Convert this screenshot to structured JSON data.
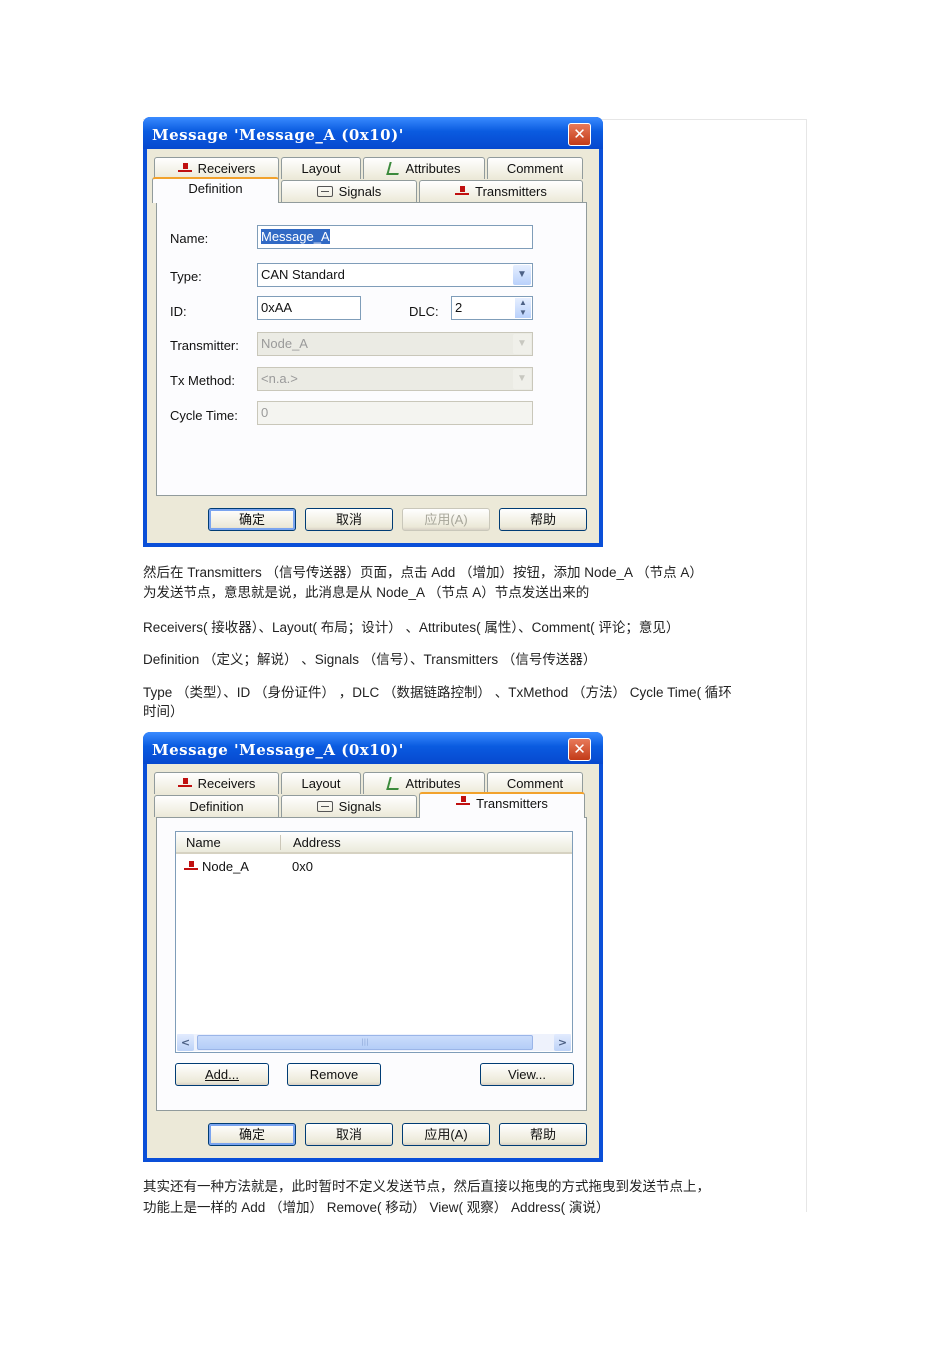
{
  "dialog1": {
    "title": "Message 'Message_A (0x10)'",
    "close_glyph": "✕",
    "tabs_row1": [
      "Receivers",
      "Layout",
      "Attributes",
      "Comment"
    ],
    "tabs_row2": [
      "Definition",
      "Signals",
      "Transmitters"
    ],
    "active_tab": "Definition",
    "fields": {
      "name_label": "Name:",
      "name_value": "Message_A",
      "type_label": "Type:",
      "type_value": "CAN Standard",
      "id_label": "ID:",
      "id_value": "0xAA",
      "dlc_label": "DLC:",
      "dlc_value": "2",
      "transmitter_label": "Transmitter:",
      "transmitter_value": "Node_A",
      "txmethod_label": "Tx Method:",
      "txmethod_value": "<n.a.>",
      "cycletime_label": "Cycle Time:",
      "cycletime_value": "0"
    },
    "buttons": {
      "ok": "确定",
      "cancel": "取消",
      "apply": "应用(A)",
      "help": "帮助"
    }
  },
  "text1": {
    "line1": "然后在   Transmitters      （信号传送器）页面，点击      Add （增加）按钮，添加      Node_A   （节点  A）",
    "line2": "为发送节点，意思就是说，此消息是从         Node_A   （节点   A）节点发送出来的",
    "line3": "Receivers(    接收器）、Layout(    布局；设计）   、Attributes(     属性）、Comment(     评论；意见）",
    "line4": "Definition      （定义；解说）  、Signals    （信号）、Transmitters       （信号传送器）",
    "line5": "Type （类型）、ID （身份证件）  ，DLC （数据链路控制）   、TxMethod     （方法）   Cycle Time(     循环",
    "line6": "时间）"
  },
  "dialog2": {
    "title": "Message 'Message_A (0x10)'",
    "close_glyph": "✕",
    "tabs_row1": [
      "Receivers",
      "Layout",
      "Attributes",
      "Comment"
    ],
    "tabs_row2": [
      "Definition",
      "Signals",
      "Transmitters"
    ],
    "active_tab": "Transmitters",
    "list": {
      "columns": [
        "Name",
        "Address"
      ],
      "rows": [
        {
          "name": "Node_A",
          "address": "0x0"
        }
      ]
    },
    "scroll_left": "<",
    "scroll_right": ">",
    "scroll_grip": "|||",
    "list_buttons": {
      "add": "Add...",
      "remove": "Remove",
      "view": "View..."
    },
    "buttons": {
      "ok": "确定",
      "cancel": "取消",
      "apply": "应用(A)",
      "help": "帮助"
    }
  },
  "text2": {
    "line1": "其实还有一种方法就是，此时暂时不定义发送节点，然后直接以拖曳的方式拖曳到发送节点上，",
    "line2": "功能上是一样的     Add  （增加）   Remove(    移动）  View(   观察）  Address(    演说）"
  },
  "icons": {
    "node": "node-icon",
    "attributes": "attributes-icon",
    "signals": "signals-icon"
  },
  "colors": {
    "titlebar": "#0a5be0",
    "dialog_bg": "#ece9d8",
    "selection": "#316ac5",
    "tab_highlight": "#f2a22c"
  }
}
